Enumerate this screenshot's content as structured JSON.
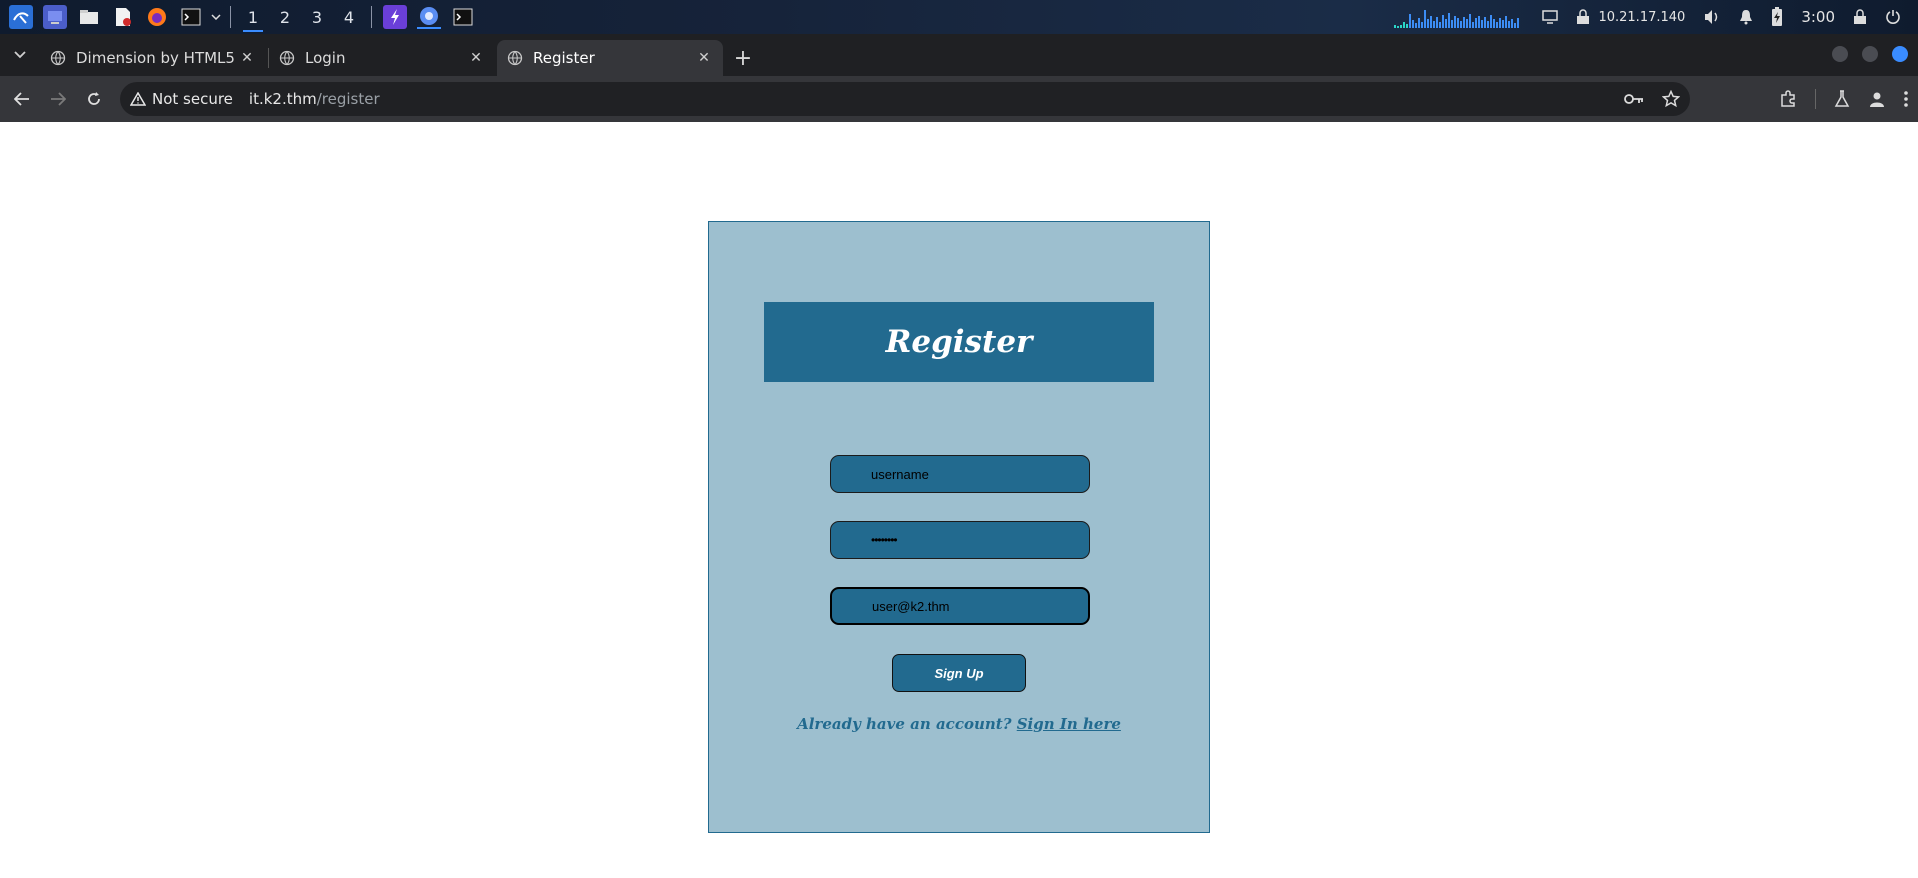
{
  "taskbar": {
    "workspaces": [
      "1",
      "2",
      "3",
      "4"
    ],
    "active_workspace": "1",
    "ip_address": "10.21.17.140",
    "clock": "3:00",
    "icons": [
      "kali-menu-icon",
      "desktop-icon",
      "file-manager-icon",
      "text-editor-icon",
      "firefox-icon",
      "terminal-icon",
      "burp-icon",
      "chromium-icon",
      "terminal-icon"
    ]
  },
  "browser": {
    "tabs": [
      {
        "title": "Dimension by HTML5 UP",
        "active": false
      },
      {
        "title": "Login",
        "active": false
      },
      {
        "title": "Register",
        "active": true
      }
    ],
    "new_tab_label": "+",
    "close_label": "✕",
    "security_label": "Not secure",
    "url_host": "it.k2.thm",
    "url_path": "/register"
  },
  "form": {
    "title": "Register",
    "username_value": "username",
    "password_value": "••••••••",
    "email_value": "user@k2.thm",
    "submit_label": "Sign Up",
    "signin_prompt": "Already have an account?",
    "signin_link": "Sign In here"
  },
  "colors": {
    "card_bg": "#9dbfcf",
    "accent": "#226a8f",
    "browser_dark": "#35363a",
    "taskbar": "#16233a",
    "link_blue": "#3a8cff"
  }
}
